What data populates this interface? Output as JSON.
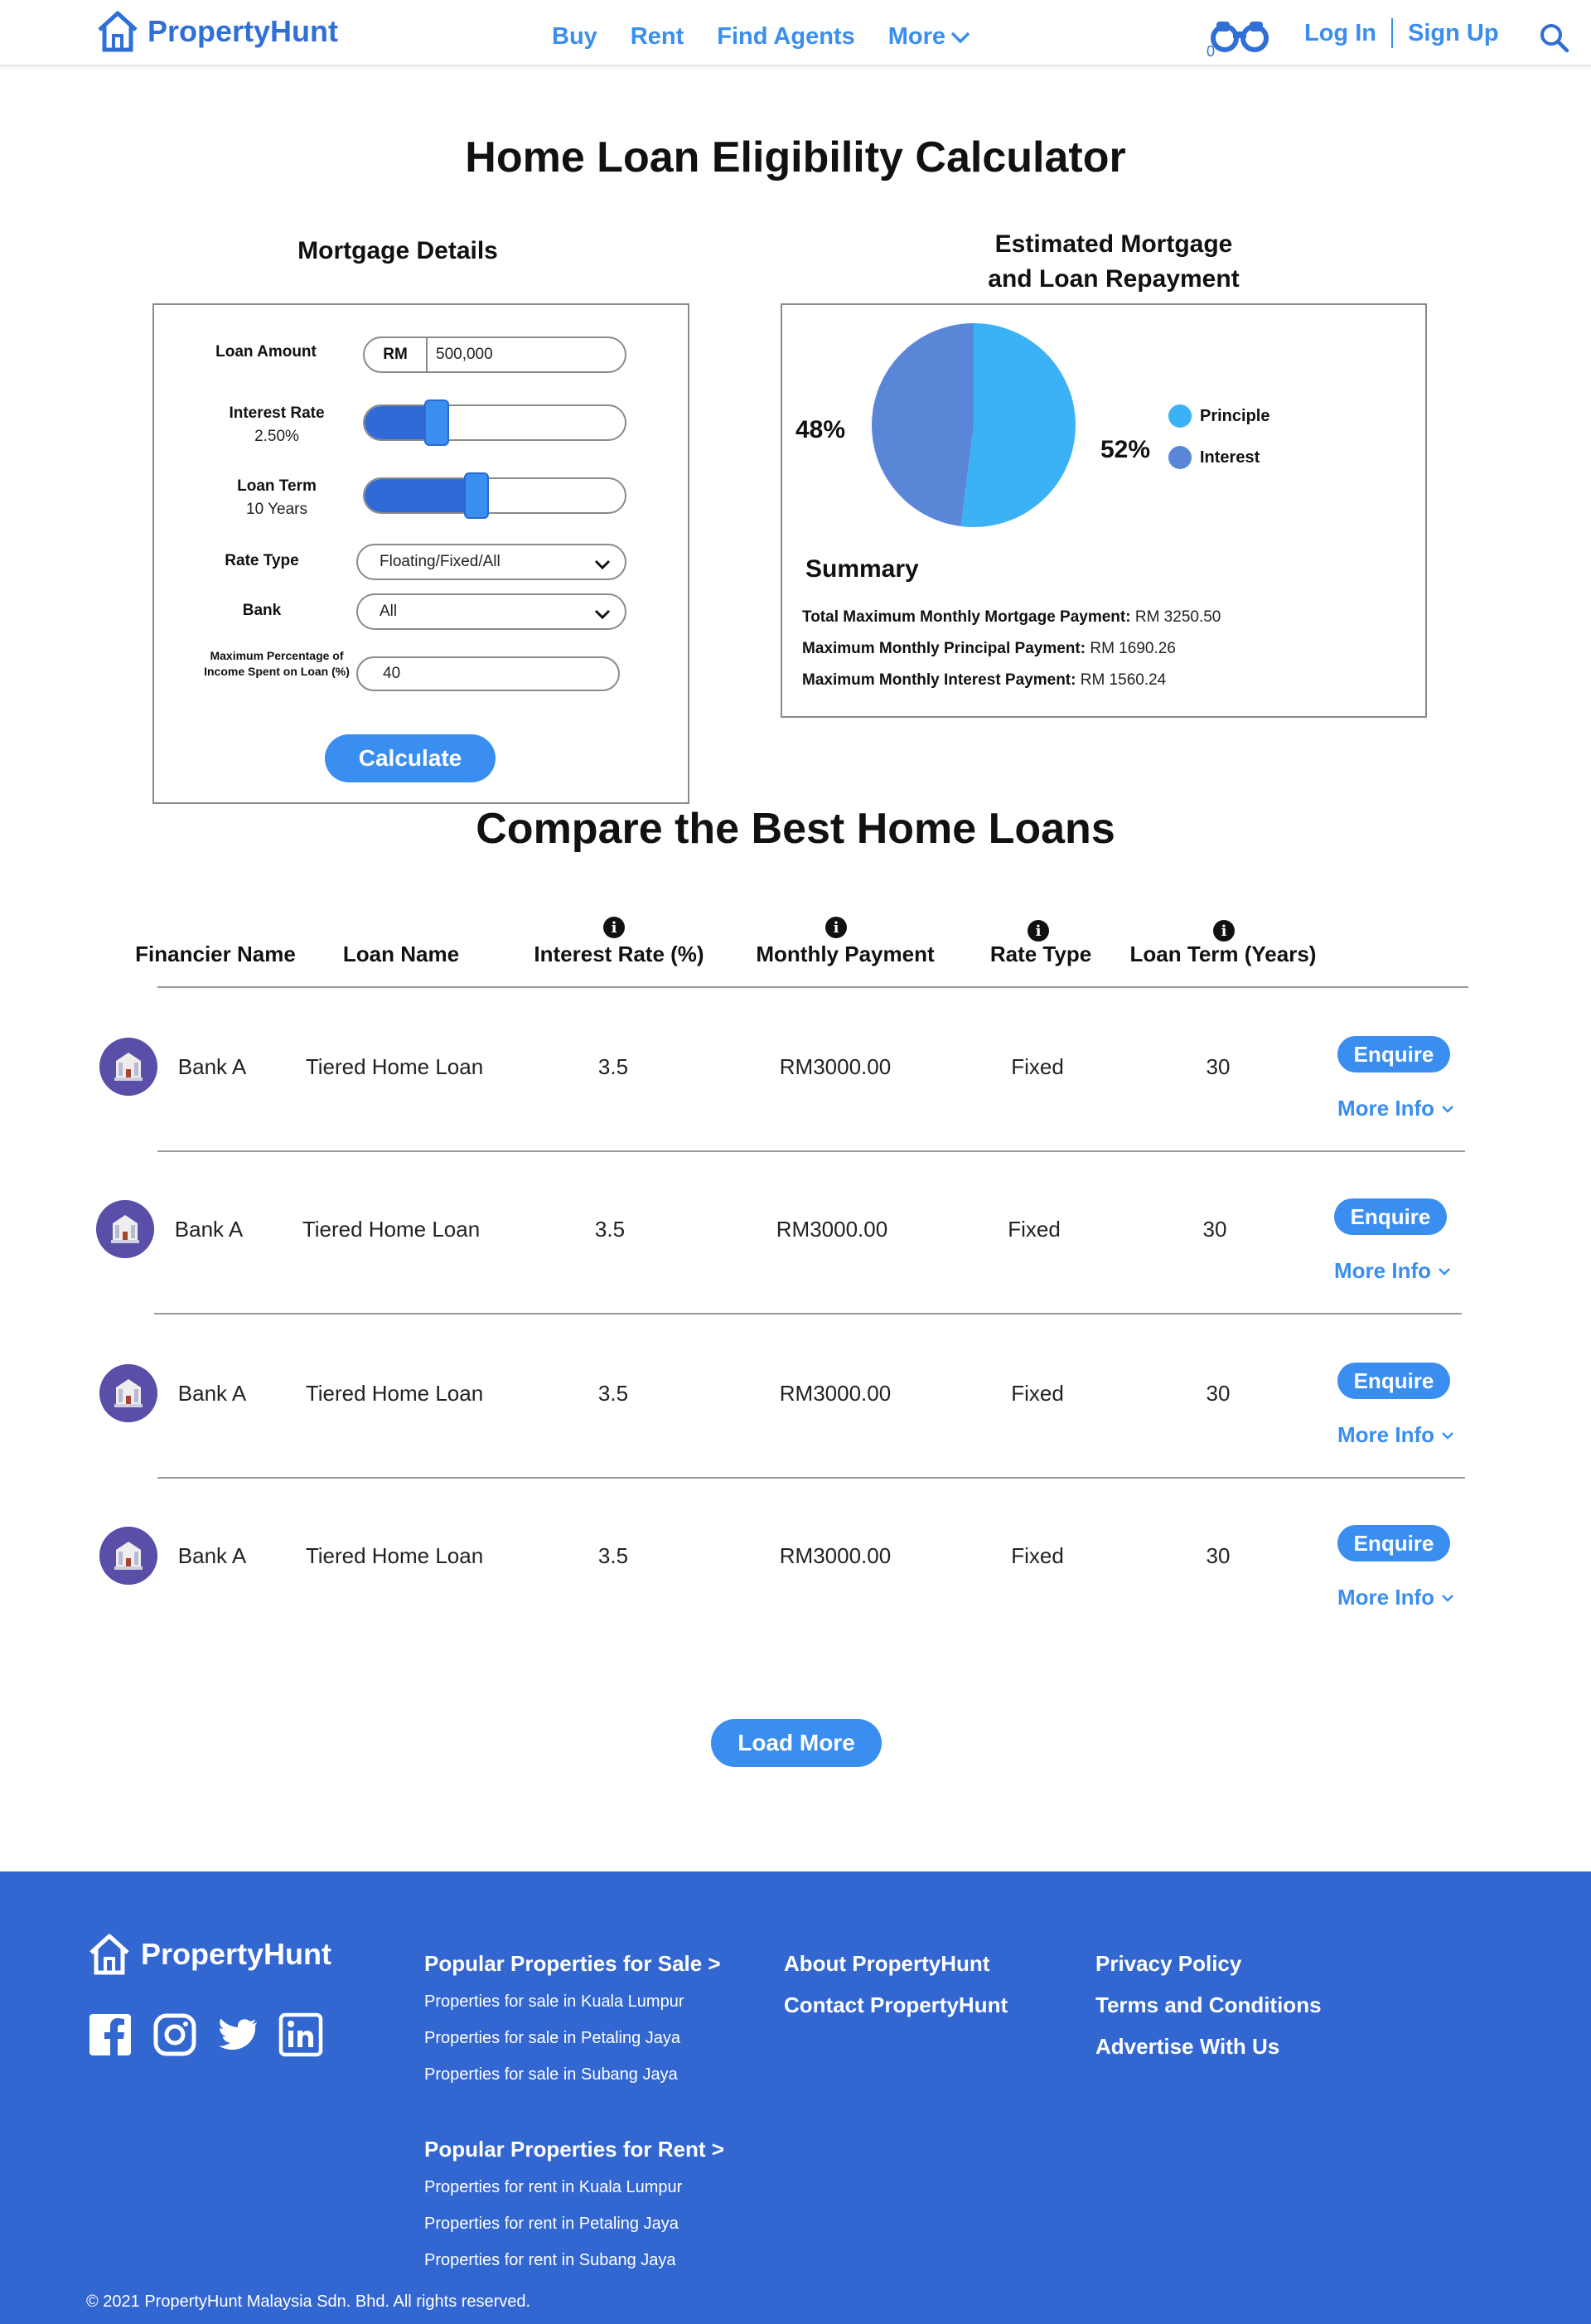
{
  "header": {
    "brand": "PropertyHunt",
    "nav": [
      "Buy",
      "Rent",
      "Find Agents",
      "More"
    ],
    "saved_count": "0",
    "login": "Log In",
    "signup": "Sign Up"
  },
  "page_title": "Home Loan Eligibility Calculator",
  "mortgage": {
    "title": "Mortgage Details",
    "loan_amount_label": "Loan Amount",
    "currency": "RM",
    "loan_amount_value": "500,000",
    "interest_rate_label": "Interest Rate",
    "interest_rate_value": "2.50%",
    "interest_rate_fraction": 0.28,
    "loan_term_label": "Loan Term",
    "loan_term_value": "10 Years",
    "loan_term_fraction": 0.43,
    "rate_type_label": "Rate Type",
    "rate_type_value": "Floating/Fixed/All",
    "bank_label": "Bank",
    "bank_value": "All",
    "max_pct_label": "Maximum Percentage of Income Spent on Loan (%)",
    "max_pct_value": "40",
    "calculate": "Calculate"
  },
  "estimate": {
    "title_line1": "Estimated Mortgage",
    "title_line2": "and Loan Repayment",
    "pct_interest": "48%",
    "pct_principle": "52%",
    "legend_principle": "Principle",
    "legend_interest": "Interest",
    "principle_fraction": 0.52,
    "color_principle": "#3cb2f6",
    "color_interest": "#5a86d8",
    "summary_title": "Summary",
    "summary": [
      {
        "label": "Total Maximum Monthly Mortgage Payment:",
        "value": "RM 3250.50"
      },
      {
        "label": "Maximum Monthly Principal Payment:",
        "value": "RM 1690.26"
      },
      {
        "label": "Maximum Monthly Interest Payment:",
        "value": "RM 1560.24"
      }
    ]
  },
  "compare": {
    "title": "Compare the Best Home Loans",
    "headers": [
      "Financier Name",
      "Loan Name",
      "Interest Rate (%)",
      "Monthly Payment",
      "Rate Type",
      "Loan Term (Years)"
    ],
    "enquire": "Enquire",
    "more_info": "More Info",
    "rows": [
      {
        "bank": "Bank A",
        "loan": "Tiered Home Loan",
        "rate": "3.5",
        "payment": "RM3000.00",
        "type": "Fixed",
        "term": "30"
      },
      {
        "bank": "Bank A",
        "loan": "Tiered Home Loan",
        "rate": "3.5",
        "payment": "RM3000.00",
        "type": "Fixed",
        "term": "30"
      },
      {
        "bank": "Bank A",
        "loan": "Tiered Home Loan",
        "rate": "3.5",
        "payment": "RM3000.00",
        "type": "Fixed",
        "term": "30"
      },
      {
        "bank": "Bank A",
        "loan": "Tiered Home Loan",
        "rate": "3.5",
        "payment": "RM3000.00",
        "type": "Fixed",
        "term": "30"
      }
    ],
    "load_more": "Load More"
  },
  "footer": {
    "brand": "PropertyHunt",
    "sale_heading": "Popular Properties for Sale >",
    "sale_links": [
      "Properties for sale in Kuala Lumpur",
      "Properties for sale in Petaling Jaya",
      "Properties for sale in Subang Jaya"
    ],
    "rent_heading": "Popular Properties for Rent >",
    "rent_links": [
      "Properties for rent in Kuala Lumpur",
      "Properties for rent in Petaling Jaya",
      "Properties for rent in Subang Jaya"
    ],
    "about": "About PropertyHunt",
    "contact": "Contact PropertyHunt",
    "privacy": "Privacy Policy",
    "terms": "Terms and Conditions",
    "advertise": "Advertise With Us",
    "copyright": "© 2021 PropertyHunt Malaysia Sdn. Bhd. All rights reserved."
  }
}
